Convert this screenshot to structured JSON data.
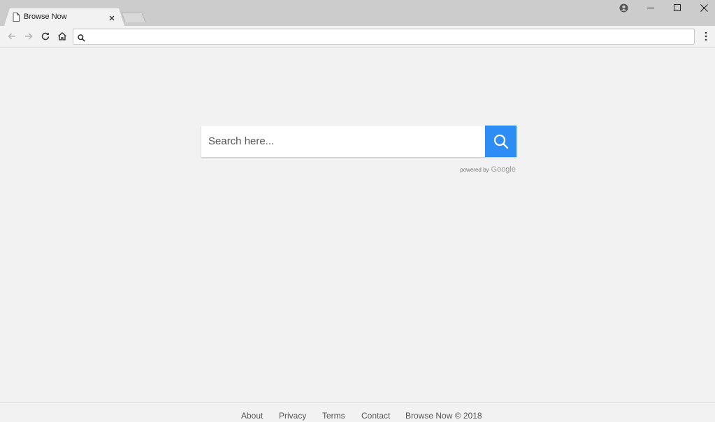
{
  "browser": {
    "tab": {
      "title": "Browse Now",
      "icon": "page-icon",
      "close_icon": "close-icon"
    },
    "window_controls": [
      "account-icon",
      "minimize-icon",
      "maximize-icon",
      "close-icon"
    ],
    "toolbar": {
      "buttons": [
        "back-icon",
        "forward-icon",
        "reload-icon",
        "home-icon"
      ],
      "omnibox": {
        "value": "",
        "placeholder": ""
      },
      "menu_icon": "more-vert-icon"
    }
  },
  "page": {
    "search": {
      "placeholder": "Search here...",
      "button_icon": "search-icon",
      "powered_by": "powered by",
      "provider": "Google",
      "accent_color": "#2e8cf5"
    },
    "footer": {
      "links": [
        "About",
        "Privacy",
        "Terms",
        "Contact"
      ],
      "copyright": "Browse Now © 2018"
    }
  }
}
